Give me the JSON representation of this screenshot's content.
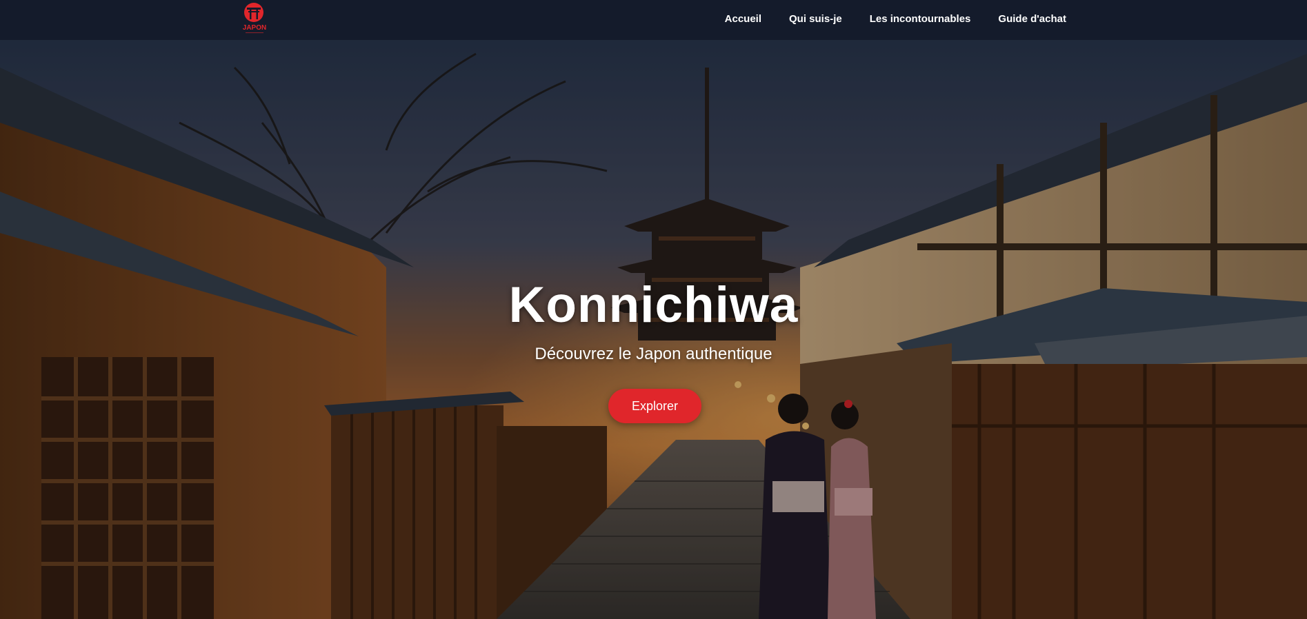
{
  "brand": {
    "logo_icon": "torii-gate-logo",
    "logo_text": "JAPON",
    "accent_color": "#e0262b"
  },
  "nav": {
    "items": [
      {
        "label": "Accueil"
      },
      {
        "label": "Qui suis-je"
      },
      {
        "label": "Les incontournables"
      },
      {
        "label": "Guide d'achat"
      }
    ]
  },
  "hero": {
    "title": "Konnichiwa",
    "subtitle": "Découvrez le Japon authentique",
    "cta_label": "Explorer",
    "background": "kyoto-street-pagoda-dusk"
  }
}
